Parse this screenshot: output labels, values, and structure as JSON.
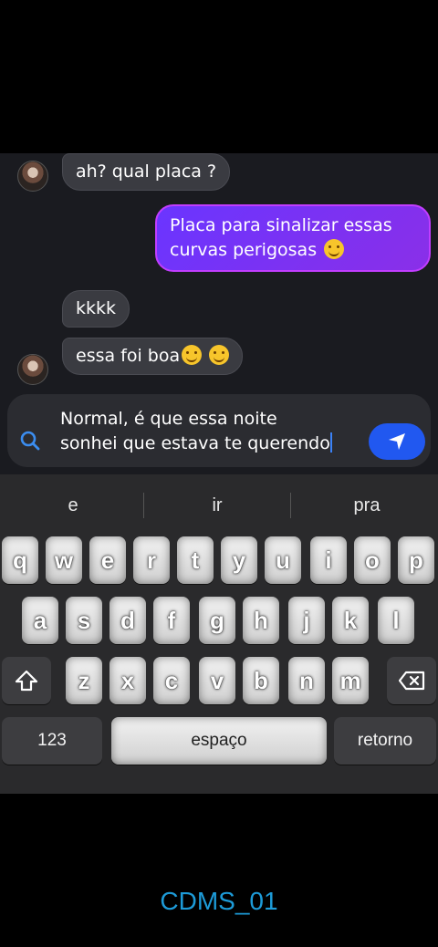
{
  "chat": {
    "messages": [
      {
        "side": "received",
        "text": "ah? qual placa ?"
      },
      {
        "side": "sent",
        "line1": "Placa para sinalizar essas",
        "line2": "curvas perigosas"
      },
      {
        "side": "received",
        "text": "kkkk"
      },
      {
        "side": "received",
        "text": "essa foi boa"
      }
    ]
  },
  "composer": {
    "line1": "Normal, é que essa noite",
    "line2": "sonhei que estava te querendo",
    "search_icon": "search-icon",
    "send_icon": "send-icon"
  },
  "keyboard": {
    "suggestions": [
      "e",
      "ir",
      "pra"
    ],
    "row1": [
      "q",
      "w",
      "e",
      "r",
      "t",
      "y",
      "u",
      "i",
      "o",
      "p"
    ],
    "row2": [
      "a",
      "s",
      "d",
      "f",
      "g",
      "h",
      "j",
      "k",
      "l"
    ],
    "row3": [
      "z",
      "x",
      "c",
      "v",
      "b",
      "n",
      "m"
    ],
    "numbers_label": "123",
    "space_label": "espaço",
    "return_label": "retorno",
    "shift_icon": "shift-icon",
    "delete_icon": "backspace-icon"
  },
  "watermark": "CDMS_01",
  "colors": {
    "sent_bubble": "#7a33f5",
    "send_button": "#2158f0",
    "watermark": "#1d9bd8"
  }
}
